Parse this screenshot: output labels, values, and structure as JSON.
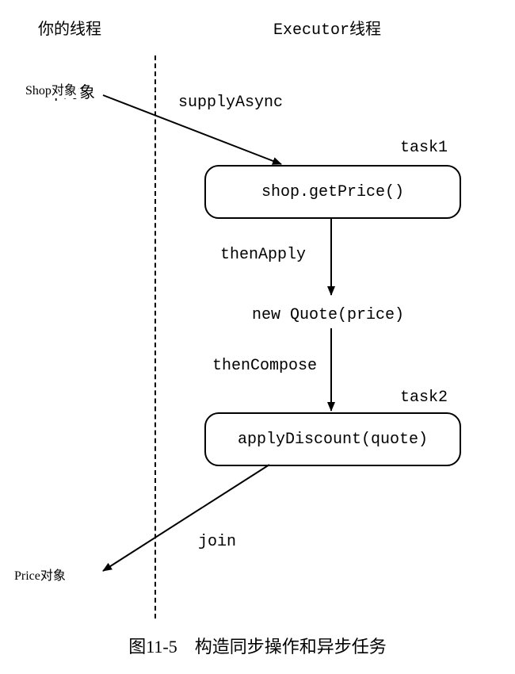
{
  "header": {
    "leftThread": "你的线程",
    "rightThread": "Executor线程"
  },
  "nodes": {
    "shopObject": "Shop对象",
    "task1Label": "task1",
    "task1Box": "shop.getPrice()",
    "quoteNode": "new Quote(price)",
    "task2Label": "task2",
    "task2Box": "applyDiscount(quote)",
    "priceObject": "Price对象"
  },
  "edges": {
    "supplyAsync": "supplyAsync",
    "thenApply": "thenApply",
    "thenCompose": "thenCompose",
    "join": "join"
  },
  "caption": "图11-5　构造同步操作和异步任务"
}
